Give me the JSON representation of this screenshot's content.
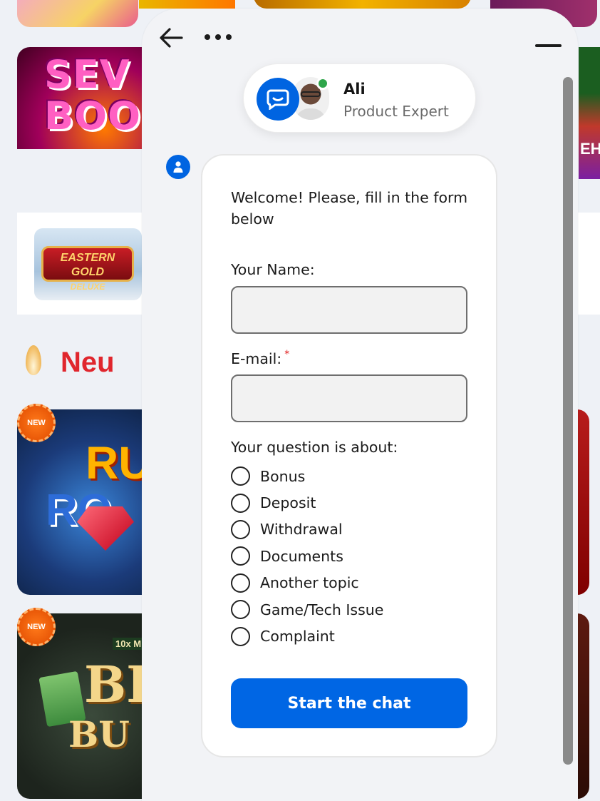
{
  "background": {
    "section_title": "Neu",
    "new_badge": "NEW",
    "tiles": {
      "seven_text": "SEVEN BOOK",
      "eastern_text": "EASTERN GOLD DELUXE",
      "ruby_text_1": "RU",
      "ruby_text_2": "RO",
      "big_text": "BI",
      "bucks_text": "BUC",
      "tenx_text": "10x M",
      "right_strip_text": "EH"
    }
  },
  "chat": {
    "header": {
      "back_icon": "arrow-left-icon",
      "more_icon": "more-horizontal-icon",
      "minimize_icon": "minimize-icon"
    },
    "agent": {
      "name": "Ali",
      "role": "Product Expert",
      "status_color": "#2ea54a"
    },
    "form": {
      "welcome": "Welcome! Please, fill in the form below",
      "name_label": "Your Name:",
      "name_value": "",
      "email_label": "E-mail:",
      "email_required_marker": "*",
      "email_value": "",
      "question_label": "Your question is about:",
      "options": [
        {
          "label": "Bonus"
        },
        {
          "label": "Deposit"
        },
        {
          "label": "Withdrawal"
        },
        {
          "label": "Documents"
        },
        {
          "label": "Another topic"
        },
        {
          "label": "Game/Tech Issue"
        },
        {
          "label": "Complaint"
        }
      ],
      "submit_label": "Start the chat"
    },
    "colors": {
      "accent": "#0066e4",
      "required": "#e02020"
    }
  }
}
